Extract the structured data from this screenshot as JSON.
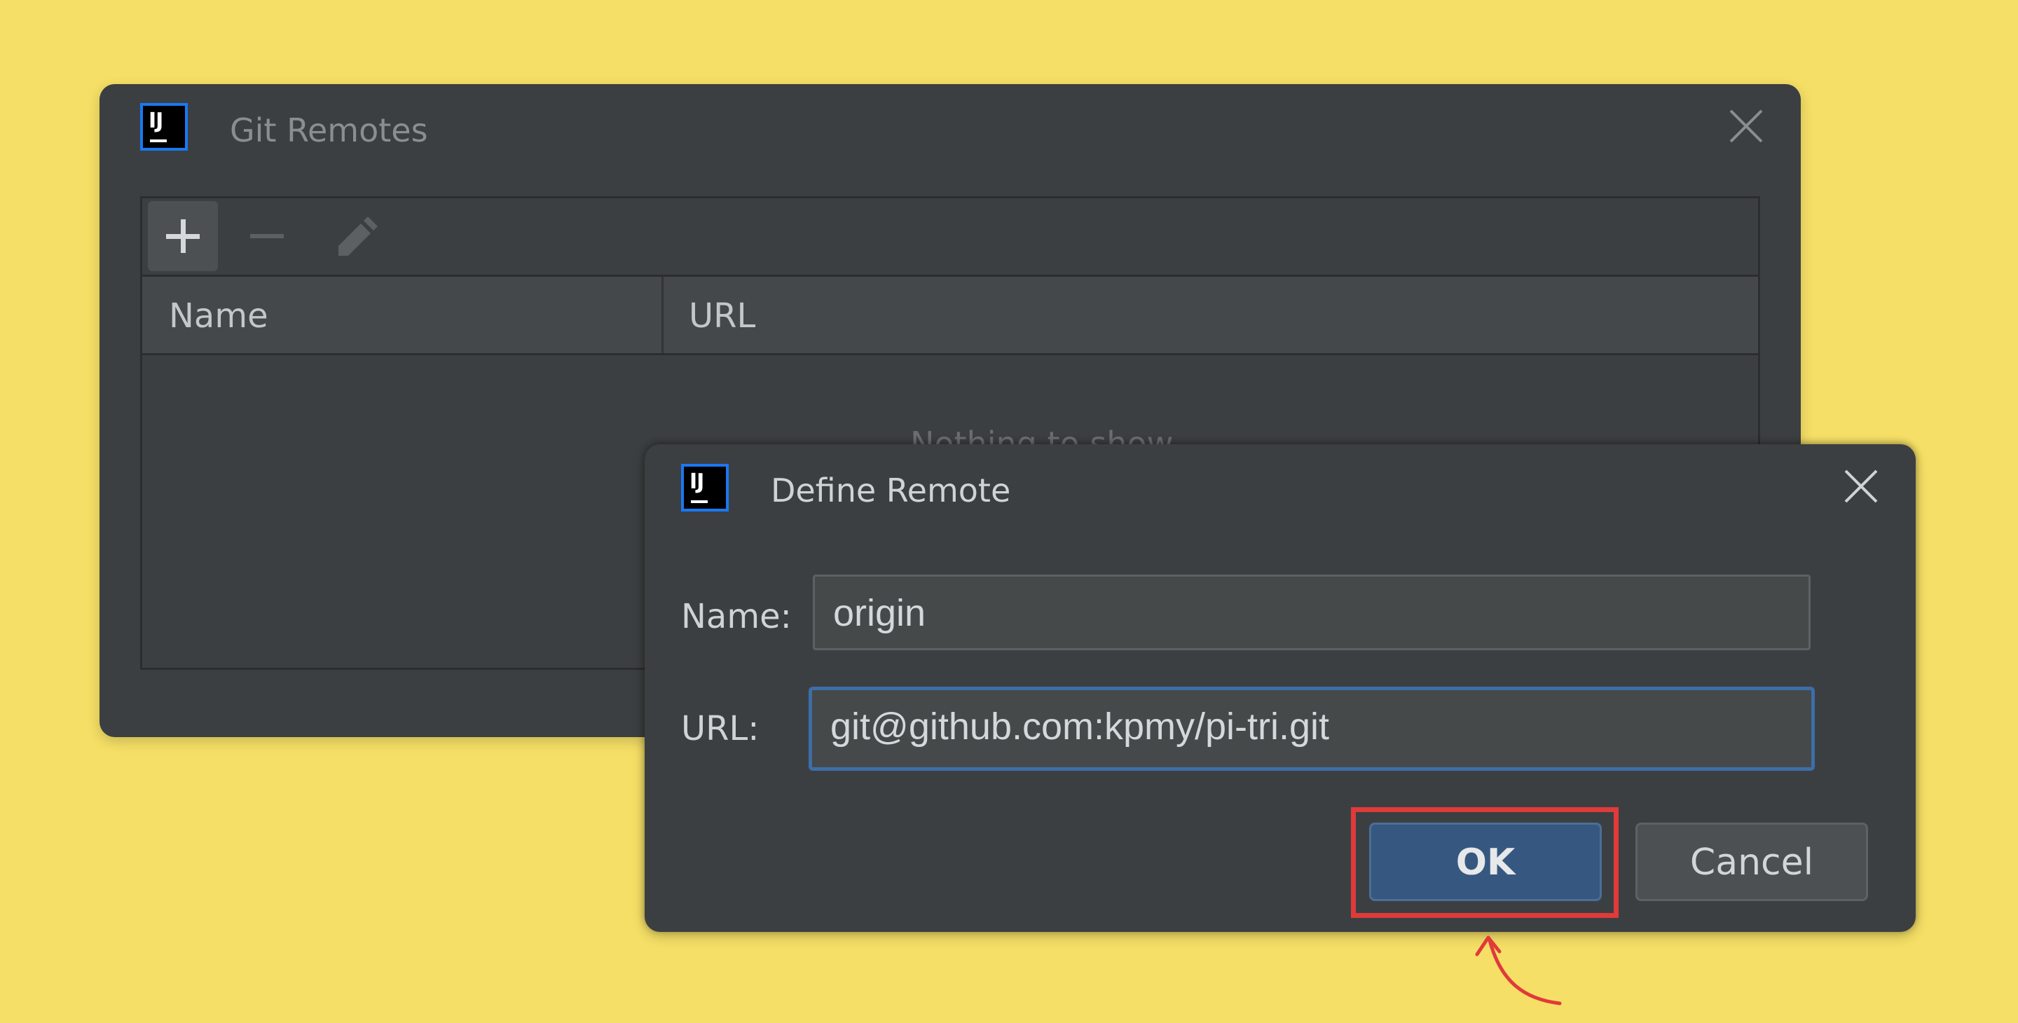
{
  "git_remotes": {
    "title": "Git Remotes",
    "logo_text": "IJ",
    "toolbar": {
      "add_icon": "plus-icon",
      "remove_icon": "minus-icon",
      "edit_icon": "pencil-icon"
    },
    "columns": [
      "Name",
      "URL"
    ],
    "empty_text": "Nothing to show"
  },
  "define_remote": {
    "title": "Define Remote",
    "logo_text": "IJ",
    "name_label": "Name:",
    "name_value": "origin",
    "url_label": "URL:",
    "url_value": "git@github.com:kpmy/pi-tri.git",
    "ok_label": "OK",
    "cancel_label": "Cancel"
  },
  "colors": {
    "background": "#f5df66",
    "dialog": "#3c3f41",
    "ok_button": "#365880",
    "focus_border": "#3d6ea8",
    "annotation": "#e03a3a"
  }
}
